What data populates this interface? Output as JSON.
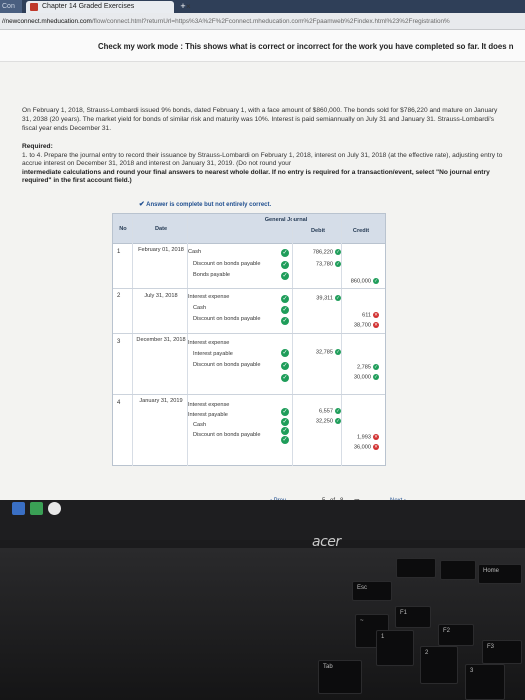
{
  "browser": {
    "inactive_tab": "Con",
    "tab_title": "Chapter 14 Graded Exercises",
    "tab_close": "×",
    "tab_new": "+",
    "url_host": "//newconnect.mheducation.com",
    "url_rest": "/flow/connect.html?returnUrl=https%3A%2F%2Fconnect.mheducation.com%2Fpaamweb%2Findex.html%23%2Fregistration%"
  },
  "banner": {
    "text": "Check my work mode : This shows what is correct or incorrect for the work you have completed so far. It does n"
  },
  "problem": {
    "text": "On February 1, 2018, Strauss-Lombardi issued 9% bonds, dated February 1, with a face amount of $860,000. The bonds sold for $786,220 and mature on January 31, 2038 (20 years). The market yield for bonds of similar risk and maturity was 10%. Interest is paid semiannually on July 31 and January 31. Strauss-Lombardi's fiscal year ends December 31."
  },
  "required": {
    "label": "Required:",
    "line1": "1. to 4. Prepare the journal entry to record their issuance by Strauss-Lombardi on February 1, 2018, interest on July 31, 2018 (at the effective rate), adjusting entry to accrue interest on December 31, 2018 and interest on January 31, 2019. (Do not round your",
    "line2": "intermediate calculations and round your final answers to nearest whole dollar. If no entry is required for a transaction/event, select \"No journal entry required\" in the first account field.)"
  },
  "answer_banner": "Answer is complete but not entirely correct.",
  "journal": {
    "title": "General Journal",
    "headers": {
      "no": "No",
      "date": "Date",
      "debit": "Debit",
      "credit": "Credit"
    },
    "entries": [
      {
        "no": "1",
        "date": "February 01, 2018",
        "lines": [
          {
            "account": "Cash",
            "debit": "786,220",
            "credit": "",
            "mark": "ok"
          },
          {
            "account": "Discount on bonds payable",
            "debit": "73,780",
            "credit": "",
            "mark": "ok"
          },
          {
            "account": "Bonds payable",
            "debit": "",
            "credit": "860,000",
            "mark": "ok"
          }
        ]
      },
      {
        "no": "2",
        "date": "July 31, 2018",
        "lines": [
          {
            "account": "Interest expense",
            "debit": "39,311",
            "credit": "",
            "mark": "ok"
          },
          {
            "account": "Cash",
            "debit": "",
            "credit": "611",
            "mark": "bad"
          },
          {
            "account": "Discount on bonds payable",
            "debit": "",
            "credit": "38,700",
            "mark": "bad"
          }
        ]
      },
      {
        "no": "3",
        "date": "December 31, 2018",
        "lines": [
          {
            "account": "Interest expense",
            "debit": "32,785",
            "credit": "",
            "mark": "ok"
          },
          {
            "account": "Interest payable",
            "debit": "",
            "credit": "2,785",
            "mark": "ok"
          },
          {
            "account": "Discount on bonds payable",
            "debit": "",
            "credit": "30,000",
            "mark": "ok"
          }
        ]
      },
      {
        "no": "4",
        "date": "January 31, 2019",
        "lines": [
          {
            "account": "Interest expense",
            "debit": "6,557",
            "credit": "",
            "mark": "ok"
          },
          {
            "account": "Interest payable",
            "debit": "32,250",
            "credit": "",
            "mark": "ok"
          },
          {
            "account": "Cash",
            "debit": "",
            "credit": "1,993",
            "mark": "bad"
          },
          {
            "account": "Discount on bonds payable",
            "debit": "",
            "credit": "36,000",
            "mark": "bad"
          }
        ]
      }
    ]
  },
  "pager": {
    "prev": "‹ Prev",
    "current": "5",
    "of": "of",
    "total": "8",
    "next": "Next ›"
  },
  "laptop": {
    "brand": "acer"
  },
  "keys": {
    "esc": "Esc",
    "f1": "F1",
    "f2": "F2",
    "f3": "F3",
    "one": "1",
    "two": "2",
    "three": "3",
    "tab": "Tab",
    "home": "Home"
  }
}
